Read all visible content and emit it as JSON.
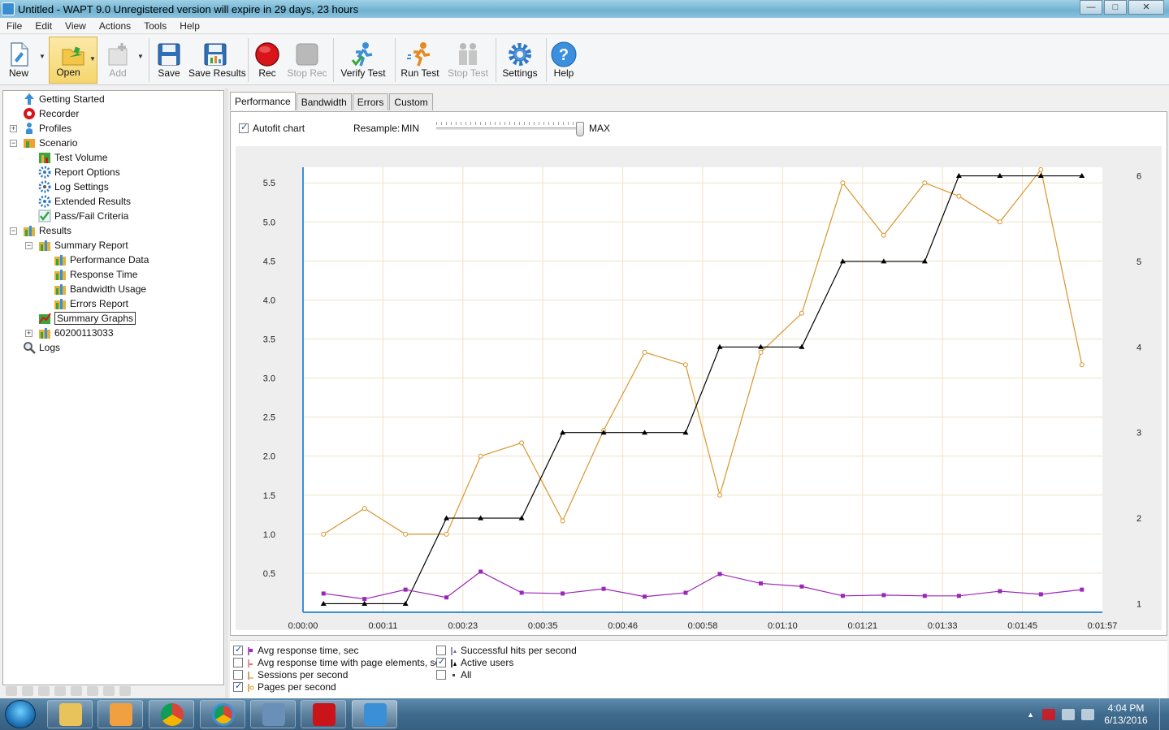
{
  "window": {
    "title": "Untitled - WAPT 9.0  Unregistered version will expire in 29 days, 23 hours",
    "controls": [
      "minimize",
      "maximize",
      "close"
    ]
  },
  "menu": [
    "File",
    "Edit",
    "View",
    "Actions",
    "Tools",
    "Help"
  ],
  "toolbar": {
    "new": "New",
    "open": "Open",
    "add": "Add",
    "save": "Save",
    "save_results": "Save Results",
    "rec": "Rec",
    "stop_rec": "Stop Rec",
    "verify_test": "Verify Test",
    "run_test": "Run Test",
    "stop_test": "Stop Test",
    "settings": "Settings",
    "help": "Help"
  },
  "tree": {
    "getting_started": "Getting Started",
    "recorder": "Recorder",
    "profiles": "Profiles",
    "scenario": "Scenario",
    "test_volume": "Test Volume",
    "report_options": "Report Options",
    "log_settings": "Log Settings",
    "extended_results": "Extended Results",
    "pass_fail": "Pass/Fail Criteria",
    "results": "Results",
    "summary_report": "Summary Report",
    "performance_data": "Performance Data",
    "response_time": "Response Time",
    "bandwidth_usage": "Bandwidth Usage",
    "errors_report": "Errors Report",
    "summary_graphs": "Summary Graphs",
    "run_id": "60200113033",
    "logs": "Logs"
  },
  "tabs": [
    "Performance",
    "Bandwidth",
    "Errors",
    "Custom"
  ],
  "chart_options": {
    "autofit_label": "Autofit chart",
    "autofit_checked": true,
    "resample_label": "Resample:",
    "min_label": "MIN",
    "max_label": "MAX",
    "resample_level": 1.0
  },
  "chart_data": {
    "type": "line",
    "x_ticks": [
      "0:00:00",
      "0:00:11",
      "0:00:23",
      "0:00:35",
      "0:00:46",
      "0:00:58",
      "0:01:10",
      "0:01:21",
      "0:01:33",
      "0:01:45",
      "0:01:57"
    ],
    "y_left_ticks": [
      "0.5",
      "1.0",
      "1.5",
      "2.0",
      "2.5",
      "3.0",
      "3.5",
      "4.0",
      "4.5",
      "5.0",
      "5.5"
    ],
    "y_right_ticks": [
      "1",
      "2",
      "3",
      "4",
      "5",
      "6"
    ],
    "x_range_seconds": [
      0,
      117
    ],
    "y_left_range": [
      0,
      5.7
    ],
    "y_right_range": [
      0.9,
      6.1
    ],
    "grid": true,
    "series": [
      {
        "name": "Pages per second",
        "axis": "left",
        "color": "#d9952b",
        "marker": "circle",
        "x_seconds": [
          3,
          9,
          15,
          21,
          26,
          32,
          38,
          44,
          50,
          56,
          61,
          67,
          73,
          79,
          85,
          91,
          96,
          102,
          108,
          114
        ],
        "values": [
          1.0,
          1.33,
          1.0,
          1.0,
          2.0,
          2.17,
          1.17,
          2.33,
          3.33,
          3.17,
          1.5,
          3.33,
          3.83,
          5.5,
          4.83,
          5.5,
          5.33,
          5.0,
          5.67,
          3.17
        ]
      },
      {
        "name": "Active users",
        "axis": "right",
        "color": "#000000",
        "marker": "triangle",
        "x_seconds": [
          3,
          9,
          15,
          21,
          26,
          32,
          38,
          44,
          50,
          56,
          61,
          67,
          73,
          79,
          85,
          91,
          96,
          102,
          108,
          114
        ],
        "values": [
          1,
          1,
          1,
          2,
          2,
          2,
          3,
          3,
          3,
          3,
          4,
          4,
          4,
          5,
          5,
          5,
          6,
          6,
          6,
          6
        ]
      },
      {
        "name": "Avg response time, sec",
        "axis": "left",
        "color": "#9b27b8",
        "marker": "square",
        "x_seconds": [
          3,
          9,
          15,
          21,
          26,
          32,
          38,
          44,
          50,
          56,
          61,
          67,
          73,
          79,
          85,
          91,
          96,
          102,
          108,
          114
        ],
        "values": [
          0.24,
          0.17,
          0.29,
          0.19,
          0.52,
          0.25,
          0.24,
          0.3,
          0.2,
          0.25,
          0.49,
          0.37,
          0.33,
          0.21,
          0.22,
          0.21,
          0.21,
          0.27,
          0.23,
          0.29
        ]
      }
    ]
  },
  "legend": [
    {
      "label": "Avg response time, sec",
      "checked": true,
      "color": "#9b27b8"
    },
    {
      "label": "Avg response time with page elements, sec",
      "checked": false,
      "color": "#e07070"
    },
    {
      "label": "Sessions per second",
      "checked": false,
      "color": "#c08040"
    },
    {
      "label": "Pages per second",
      "checked": true,
      "color": "#d9952b"
    },
    {
      "label": "Successful hits per second",
      "checked": false,
      "color": "#6a6a9a"
    },
    {
      "label": "Active users",
      "checked": true,
      "color": "#000000"
    },
    {
      "label": "All",
      "checked": false,
      "color": "#444444"
    }
  ],
  "taskbar": {
    "time": "4:04 PM",
    "date": "6/13/2016"
  }
}
